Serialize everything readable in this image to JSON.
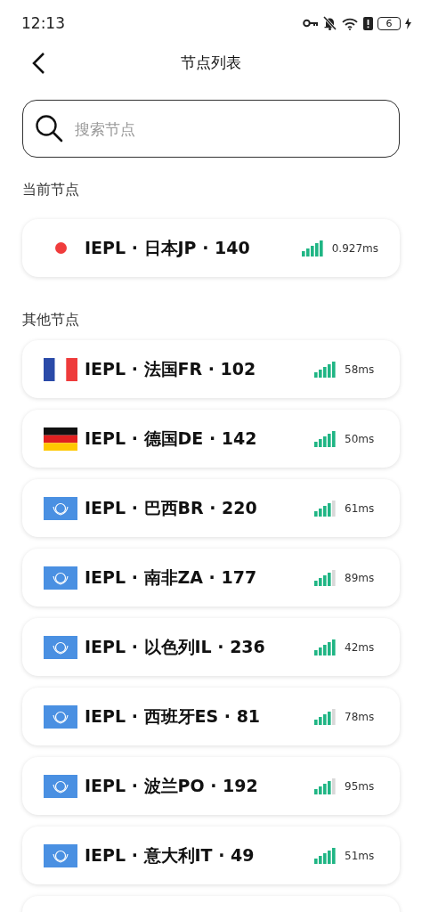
{
  "status_bar": {
    "time": "12:13",
    "battery": "6"
  },
  "header": {
    "title": "节点列表"
  },
  "search": {
    "placeholder": "搜索节点"
  },
  "current_section": {
    "title": "当前节点",
    "node": {
      "kind": "dot",
      "color": "#f03c3c",
      "name": "IEPL · 日本JP · 140",
      "signal": {
        "kind": "full"
      },
      "latency": "0.927ms"
    }
  },
  "other_section": {
    "title": "其他节点",
    "nodes": [
      {
        "kind": "france",
        "name": "IEPL · 法国FR · 102",
        "signal": {
          "kind": "full"
        },
        "latency": "58ms"
      },
      {
        "kind": "germany",
        "name": "IEPL · 德国DE · 142",
        "signal": {
          "kind": "full"
        },
        "latency": "50ms"
      },
      {
        "kind": "un",
        "name": "IEPL · 巴西BR · 220",
        "signal": {
          "kind": "partial"
        },
        "latency": "61ms"
      },
      {
        "kind": "un",
        "name": "IEPL · 南非ZA · 177",
        "signal": {
          "kind": "partial"
        },
        "latency": "89ms"
      },
      {
        "kind": "un",
        "name": "IEPL · 以色列IL · 236",
        "signal": {
          "kind": "full"
        },
        "latency": "42ms"
      },
      {
        "kind": "un",
        "name": "IEPL · 西班牙ES · 81",
        "signal": {
          "kind": "partial"
        },
        "latency": "78ms"
      },
      {
        "kind": "un",
        "name": "IEPL · 波兰PO · 192",
        "signal": {
          "kind": "partial"
        },
        "latency": "95ms"
      },
      {
        "kind": "un",
        "name": "IEPL · 意大利IT · 49",
        "signal": {
          "kind": "full"
        },
        "latency": "51ms"
      },
      {
        "kind": "empty"
      }
    ]
  }
}
